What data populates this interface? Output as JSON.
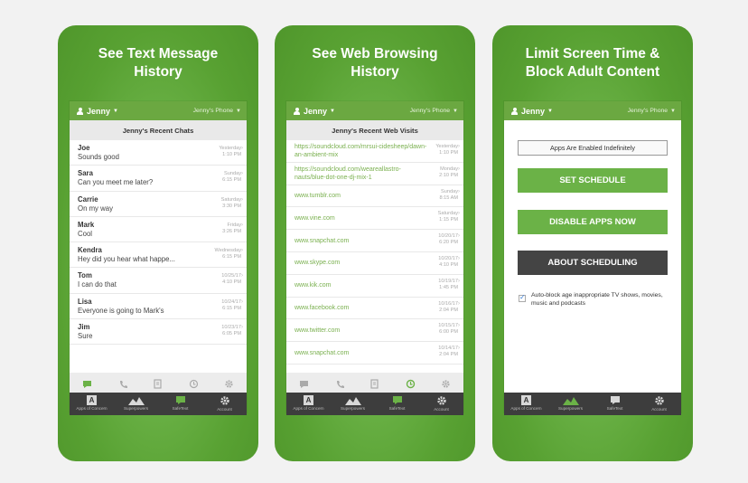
{
  "colors": {
    "brand_green": "#6bb247",
    "dark_bar": "#3d3d3d",
    "link_green": "#7ab04f"
  },
  "shared": {
    "user_name": "Jenny",
    "device_name": "Jenny's Phone",
    "tabs": [
      "Apps of Concern",
      "Superpowers",
      "SafeText",
      "Account"
    ],
    "icons": [
      "chat-icon",
      "phone-icon",
      "document-icon",
      "history-icon",
      "gear-icon"
    ]
  },
  "panel1": {
    "title": "See Text Message History",
    "header": "Jenny's Recent Chats",
    "chats": [
      {
        "name": "Joe",
        "message": "Sounds good",
        "date": "Yesterday",
        "time": "1:10 PM"
      },
      {
        "name": "Sara",
        "message": "Can you meet me later?",
        "date": "Sunday",
        "time": "6:15 PM"
      },
      {
        "name": "Carrie",
        "message": "On my way",
        "date": "Saturday",
        "time": "3:30 PM"
      },
      {
        "name": "Mark",
        "message": "Cool",
        "date": "Friday",
        "time": "3:26 PM"
      },
      {
        "name": "Kendra",
        "message": "Hey did you hear what happe...",
        "date": "Wednesday",
        "time": "6:15 PM"
      },
      {
        "name": "Tom",
        "message": "I can do that",
        "date": "10/25/17",
        "time": "4:10 PM"
      },
      {
        "name": "Lisa",
        "message": "Everyone is going to Mark's",
        "date": "10/24/17",
        "time": "6:15 PM"
      },
      {
        "name": "Jim",
        "message": "Sure",
        "date": "10/23/17",
        "time": "6:05 PM"
      }
    ]
  },
  "panel2": {
    "title": "See Web Browsing History",
    "header": "Jenny's Recent Web Visits",
    "visits": [
      {
        "url": "https://soundcloud.com/mrsui-cidesheep/dawn-an-ambient-mix",
        "date": "Yesterday",
        "time": "1:10 PM"
      },
      {
        "url": "https://soundcloud.com/weareallastro-nauts/blue-dot-one-dj-mix-1",
        "date": "Monday",
        "time": "2:10 PM"
      },
      {
        "url": "www.tumblr.com",
        "date": "Sunday",
        "time": "8:15 AM"
      },
      {
        "url": "www.vine.com",
        "date": "Saturday",
        "time": "1:15 PM"
      },
      {
        "url": "www.snapchat.com",
        "date": "10/20/17",
        "time": "6:20 PM"
      },
      {
        "url": "www.skype.com",
        "date": "10/20/17",
        "time": "4:10 PM"
      },
      {
        "url": "www.kik.com",
        "date": "10/19/17",
        "time": "1:45 PM"
      },
      {
        "url": "www.facebook.com",
        "date": "10/16/17",
        "time": "2:04 PM"
      },
      {
        "url": "www.twitter.com",
        "date": "10/15/17",
        "time": "6:00 PM"
      },
      {
        "url": "www.snapchat.com",
        "date": "10/14/17",
        "time": "2:04 PM"
      }
    ]
  },
  "panel3": {
    "title": "Limit Screen Time & Block Adult Content",
    "status": "Apps Are Enabled Indefinitely",
    "set_schedule": "SET SCHEDULE",
    "disable_apps": "DISABLE APPS NOW",
    "about_scheduling": "ABOUT SCHEDULING",
    "auto_block": "Auto-block age inappropriate TV shows, movies, music and podcasts"
  }
}
